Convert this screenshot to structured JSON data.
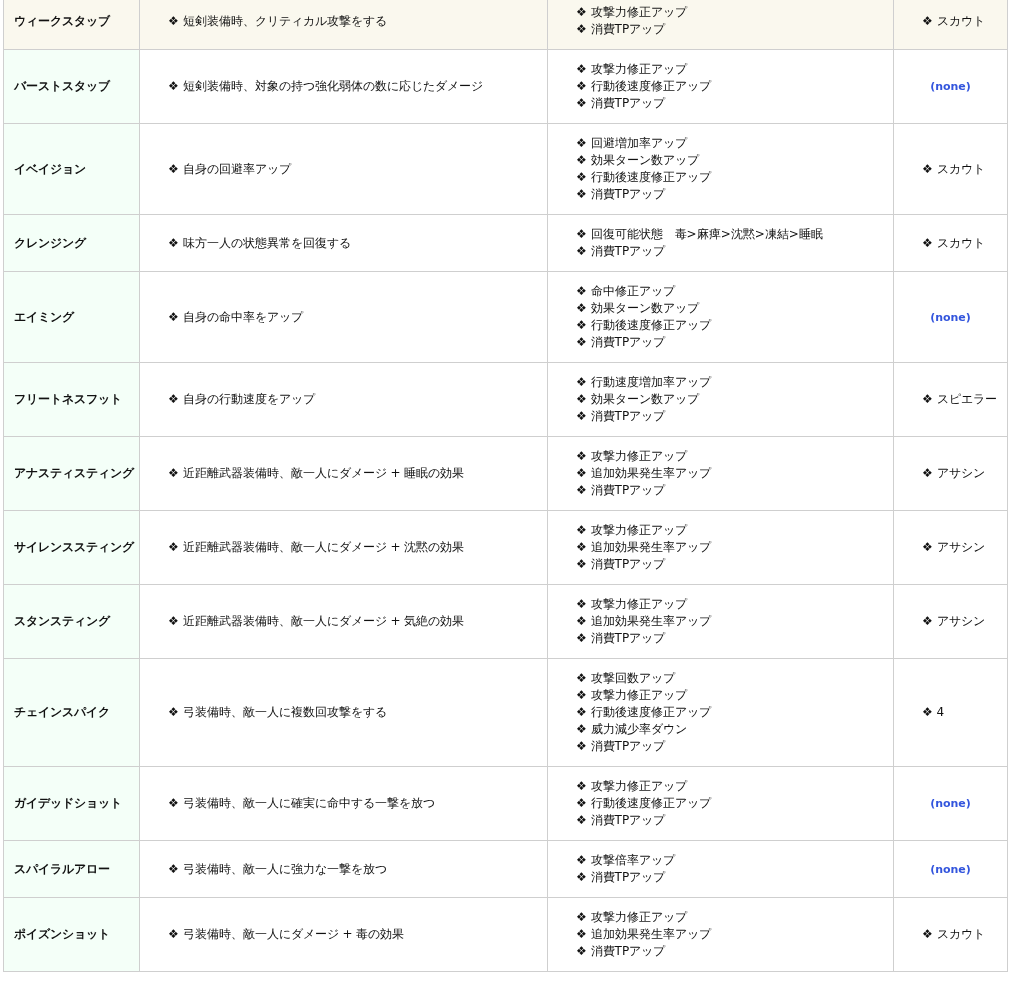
{
  "rows": [
    {
      "name": "ウィークスタッブ",
      "highlighted": true,
      "description": "❖ 短剣装備時、クリティカル攻撃をする",
      "effects": [
        "❖ 攻撃力修正アップ",
        "❖ 消費TPアップ"
      ],
      "requirement": {
        "kind": "item",
        "text": "❖ スカウト"
      }
    },
    {
      "name": "バーストスタッブ",
      "highlighted": false,
      "description": "❖ 短剣装備時、対象の持つ強化弱体の数に応じたダメージ",
      "effects": [
        "❖ 攻撃力修正アップ",
        "❖ 行動後速度修正アップ",
        "❖ 消費TPアップ"
      ],
      "requirement": {
        "kind": "none",
        "text": "(none)"
      }
    },
    {
      "name": "イベイジョン",
      "highlighted": false,
      "description": "❖ 自身の回避率アップ",
      "effects": [
        "❖ 回避増加率アップ",
        "❖ 効果ターン数アップ",
        "❖ 行動後速度修正アップ",
        "❖ 消費TPアップ"
      ],
      "requirement": {
        "kind": "item",
        "text": "❖ スカウト"
      }
    },
    {
      "name": "クレンジング",
      "highlighted": false,
      "description": "❖ 味方一人の状態異常を回復する",
      "effects": [
        "❖ 回復可能状態　毒>麻痺>沈黙>凍結>睡眠",
        "❖ 消費TPアップ"
      ],
      "requirement": {
        "kind": "item",
        "text": "❖ スカウト"
      }
    },
    {
      "name": "エイミング",
      "highlighted": false,
      "description": "❖ 自身の命中率をアップ",
      "effects": [
        "❖ 命中修正アップ",
        "❖ 効果ターン数アップ",
        "❖ 行動後速度修正アップ",
        "❖ 消費TPアップ"
      ],
      "requirement": {
        "kind": "none",
        "text": "(none)"
      }
    },
    {
      "name": "フリートネスフット",
      "highlighted": false,
      "description": "❖ 自身の行動速度をアップ",
      "effects": [
        "❖ 行動速度増加率アップ",
        "❖ 効果ターン数アップ",
        "❖ 消費TPアップ"
      ],
      "requirement": {
        "kind": "item",
        "text": "❖ スピエラー"
      }
    },
    {
      "name": "アナスティスティング",
      "highlighted": false,
      "description": "❖ 近距離武器装備時、敵一人にダメージ + 睡眠の効果",
      "effects": [
        "❖ 攻撃力修正アップ",
        "❖ 追加効果発生率アップ",
        "❖ 消費TPアップ"
      ],
      "requirement": {
        "kind": "item",
        "text": "❖ アサシン"
      }
    },
    {
      "name": "サイレンススティング",
      "highlighted": false,
      "description": "❖ 近距離武器装備時、敵一人にダメージ + 沈黙の効果",
      "effects": [
        "❖ 攻撃力修正アップ",
        "❖ 追加効果発生率アップ",
        "❖ 消費TPアップ"
      ],
      "requirement": {
        "kind": "item",
        "text": "❖ アサシン"
      }
    },
    {
      "name": "スタンスティング",
      "highlighted": false,
      "description": "❖ 近距離武器装備時、敵一人にダメージ + 気絶の効果",
      "effects": [
        "❖ 攻撃力修正アップ",
        "❖ 追加効果発生率アップ",
        "❖ 消費TPアップ"
      ],
      "requirement": {
        "kind": "item",
        "text": "❖ アサシン"
      }
    },
    {
      "name": "チェインスパイク",
      "highlighted": false,
      "description": "❖ 弓装備時、敵一人に複数回攻撃をする",
      "effects": [
        "❖ 攻撃回数アップ",
        "❖ 攻撃力修正アップ",
        "❖ 行動後速度修正アップ",
        "❖ 威力減少率ダウン",
        "❖ 消費TPアップ"
      ],
      "requirement": {
        "kind": "item",
        "text": "❖ 4"
      }
    },
    {
      "name": "ガイデッドショット",
      "highlighted": false,
      "description": "❖ 弓装備時、敵一人に確実に命中する一撃を放つ",
      "effects": [
        "❖ 攻撃力修正アップ",
        "❖ 行動後速度修正アップ",
        "❖ 消費TPアップ"
      ],
      "requirement": {
        "kind": "none",
        "text": "(none)"
      }
    },
    {
      "name": "スパイラルアロー",
      "highlighted": false,
      "description": "❖ 弓装備時、敵一人に強力な一撃を放つ",
      "effects": [
        "❖ 攻撃倍率アップ",
        "❖ 消費TPアップ"
      ],
      "requirement": {
        "kind": "none",
        "text": "(none)"
      }
    },
    {
      "name": "ポイズンショット",
      "highlighted": false,
      "description": "❖ 弓装備時、敵一人にダメージ + 毒の効果",
      "effects": [
        "❖ 攻撃力修正アップ",
        "❖ 追加効果発生率アップ",
        "❖ 消費TPアップ"
      ],
      "requirement": {
        "kind": "item",
        "text": "❖ スカウト"
      }
    }
  ]
}
